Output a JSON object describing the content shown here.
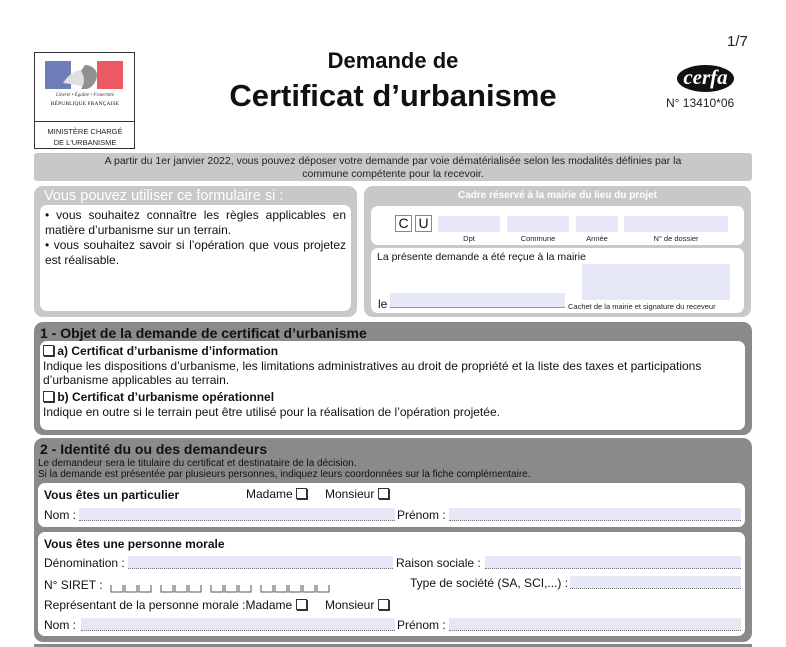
{
  "header": {
    "logo": {
      "motto": "Liberté • Égalité • Fraternité",
      "republic": "RÉPUBLIQUE FRANÇAISE",
      "ministry_line1": "MINISTÈRE CHARGÉ",
      "ministry_line2": "DE L'URBANISME"
    },
    "title_line1": "Demande de",
    "title_line2": "Certificat d’urbanisme",
    "page": "1/7",
    "cerfa_logo": "cerfa",
    "cerfa_number": "N° 13410*06"
  },
  "banner": {
    "line1": "A partir du 1er janvier 2022, vous pouvez déposer votre demande par voie dématérialisée selon les modalités définies par la",
    "line2": "commune compétente pour la recevoir."
  },
  "usage_box": {
    "title": "Vous pouvez utiliser ce formulaire si :",
    "bullet1": "• vous souhaitez connaître les règles applicables en matière d’urbanisme sur un terrain.",
    "bullet2": "• vous souhaitez savoir si l’opération que vous projetez est réalisable."
  },
  "mairie_box": {
    "title": "Cadre réservé à la mairie du lieu du projet",
    "cu_letter1": "C",
    "cu_letter2": "U",
    "label_dpt": "Dpt",
    "label_commune": "Commune",
    "label_annee": "Année",
    "label_dossier": "N° de dossier",
    "received_text": "La présente demande a été reçue à la mairie",
    "le_label": "le",
    "cachet_text": "Cachet de la mairie et signature du receveur"
  },
  "section1": {
    "title": "1 - Objet de la demande de certificat d’urbanisme",
    "option_a_label": "a) Certificat d’urbanisme d’information",
    "option_a_desc1": "Indique les dispositions d’urbanisme, les limitations administratives au droit de propriété et la liste des taxes et participations",
    "option_a_desc2": "d’urbanisme applicables au terrain.",
    "option_b_label": "b) Certificat d’urbanisme opérationnel",
    "option_b_desc": "Indique en outre si le terrain peut être utilisé pour la réalisation de l’opération projetée."
  },
  "section2": {
    "title": "2 - Identité du ou des demandeurs",
    "note1": "Le demandeur sera le titulaire du certificat et destinataire de la décision.",
    "note2": "Si la demande est présentée par plusieurs personnes, indiquez leurs coordonnées sur la fiche complémentaire.",
    "particulier": {
      "heading": "Vous êtes un particulier",
      "madame": "Madame",
      "monsieur": "Monsieur",
      "nom": "Nom :",
      "prenom": "Prénom :"
    },
    "morale": {
      "heading": "Vous êtes une personne morale",
      "denomination": "Dénomination :",
      "raison_sociale": "Raison sociale :",
      "siret": "N° SIRET :",
      "type_societe": "Type de société (SA, SCI,...) :",
      "representant": "Représentant de la personne morale :",
      "madame": "Madame",
      "monsieur": "Monsieur",
      "nom": "Nom :",
      "prenom": "Prénom :"
    }
  }
}
